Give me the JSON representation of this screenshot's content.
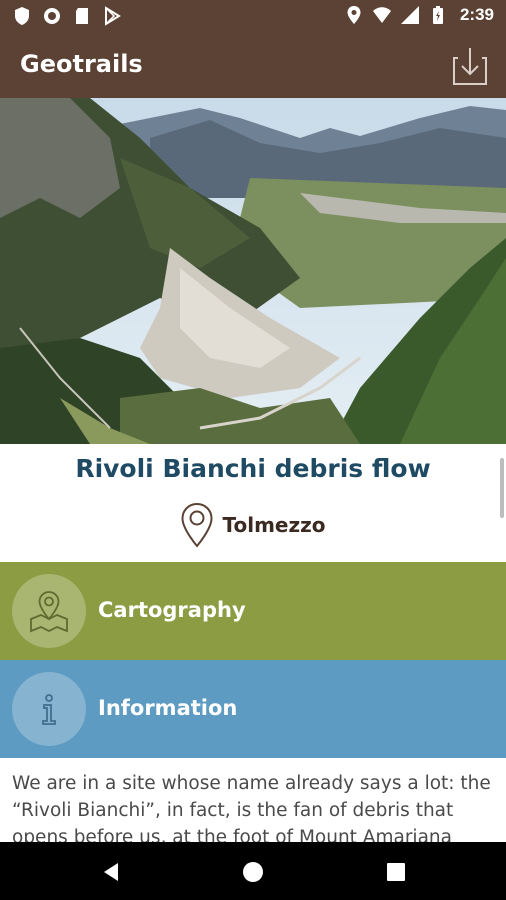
{
  "status_bar": {
    "time": "2:39",
    "left_icons": [
      "shield-icon",
      "record-icon",
      "sd-card-icon",
      "play-store-icon"
    ],
    "right_icons": [
      "location-icon",
      "wifi-icon",
      "signal-icon",
      "battery-icon"
    ]
  },
  "app_bar": {
    "title": "Geotrails",
    "action_icon": "download-icon"
  },
  "site": {
    "title": "Rivoli Bianchi debris flow",
    "location": "Tolmezzo"
  },
  "sections": {
    "cartography": "Cartography",
    "information": "Information"
  },
  "description": "We are in a site whose name already says a lot: the “Rivoli Bianchi”, in fact, is the fan of debris that opens before us, at the foot of Mount Amariana",
  "colors": {
    "app_bar": "#5b4234",
    "title_text": "#1f4a63",
    "cartography": "#8b9c42",
    "information": "#5d9bc2"
  },
  "nav": [
    "back-icon",
    "home-icon",
    "recents-icon"
  ]
}
